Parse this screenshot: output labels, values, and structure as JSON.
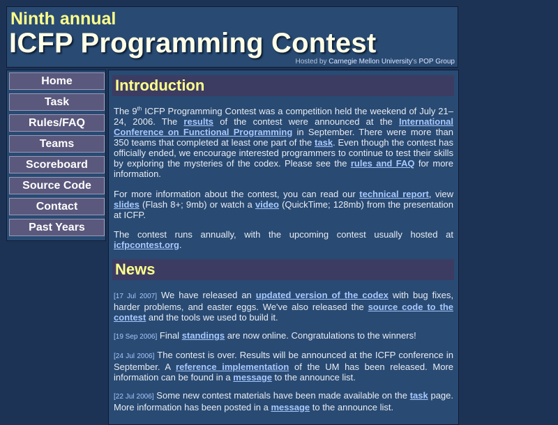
{
  "header": {
    "line1": "Ninth annual",
    "title": "ICFP Programming Contest",
    "hosted_by_prefix": "Hosted by",
    "hosted_by_university": "Carnegie Mellon University",
    "hosted_by_possessive": "'s",
    "hosted_by_group": "POP Group"
  },
  "nav": {
    "items": [
      "Home",
      "Task",
      "Rules/FAQ",
      "Teams",
      "Scoreboard",
      "Source Code",
      "Contact",
      "Past Years"
    ]
  },
  "intro": {
    "title": "Introduction",
    "p1": {
      "t1": "The 9",
      "sup": "th",
      "t2": " ICFP Programming Contest was a competition held the weekend of July 21–24, 2006. The ",
      "l1": "results",
      "t3": " of the contest were announced at the ",
      "l2": "International Conference on Functional Programming",
      "t4": " in September. There were more than 350 teams that completed at least one part of the ",
      "l3": "task",
      "t5": ". Even though the contest has officially ended, we encourage interested programmers to continue to test their skills by exploring the mysteries of the codex. Please see the ",
      "l4": "rules and FAQ",
      "t6": " for more information."
    },
    "p2": {
      "t1": "For more information about the contest, you can read our ",
      "l1": "technical report",
      "t2": ", view ",
      "l2": "slides",
      "t3": " (Flash 8+; 9mb) or watch a ",
      "l3": "video",
      "t4": " (QuickTime; 128mb) from the presentation at ICFP."
    },
    "p3": {
      "t1": "The contest runs annually, with the upcoming contest usually hosted at ",
      "l1": "icfpcontest.org",
      "t2": "."
    }
  },
  "news": {
    "title": "News",
    "items": [
      {
        "date": "[17 Jul 2007]",
        "t1": " We have released an ",
        "l1": "updated version of the codex",
        "t2": " with bug fixes, harder problems, and easter eggs. We've also released the ",
        "l2": "source code to the contest",
        "t3": " and the tools we used to build it."
      },
      {
        "date": "[19 Sep 2006]",
        "t1": " Final ",
        "l1": "standings",
        "t2": " are now online. Congratulations to the winners!"
      },
      {
        "date": "[24 Jul 2006]",
        "t1": " The contest is over. Results will be announced at the ICFP conference in September. A ",
        "l1": "reference implementation",
        "t2": " of the UM has been released. More information can be found in a ",
        "l2": "message",
        "t3": " to the announce list."
      },
      {
        "date": "[22 Jul 2006]",
        "t1": " Some new contest materials have been made available on the ",
        "l1": "task",
        "t2": " page. More information has been posted in a ",
        "l2": "message",
        "t3": " to the announce list."
      }
    ]
  }
}
